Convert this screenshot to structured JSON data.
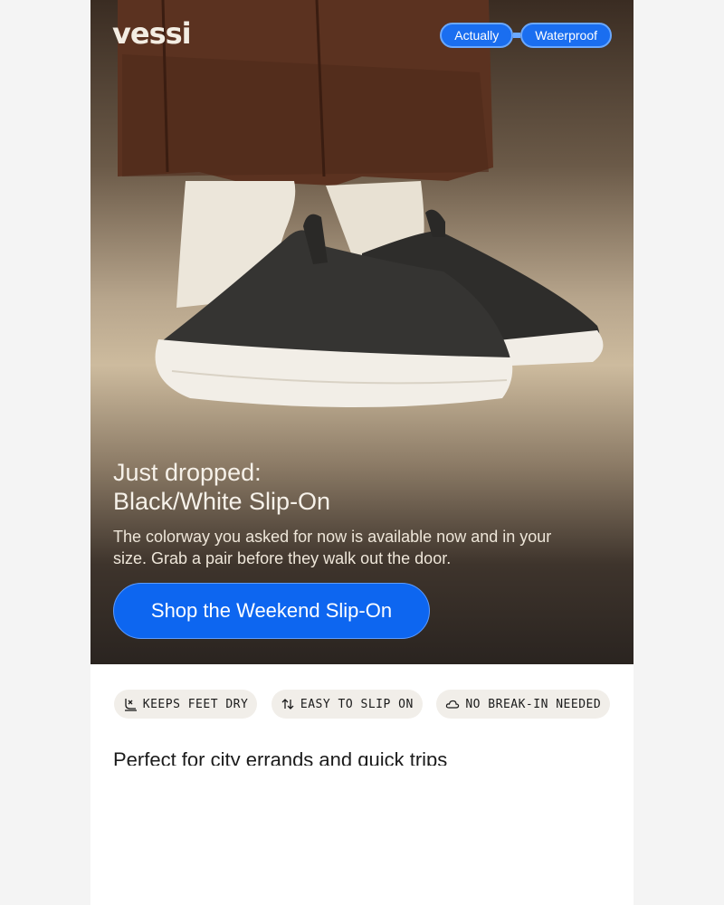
{
  "brand": {
    "logo_text": "vessi"
  },
  "hero": {
    "badges": [
      "Actually",
      "Waterproof"
    ],
    "title_line1": "Just dropped:",
    "title_line2": "Black/White Slip-On",
    "body": "The colorway you asked for now is available now and in your size. Grab a pair before they walk out the door.",
    "cta_label": "Shop the Weekend Slip-On"
  },
  "features": [
    {
      "icon": "dry-feet-icon",
      "label": "KEEPS FEET DRY"
    },
    {
      "icon": "slip-arrows-icon",
      "label": "EASY TO SLIP ON"
    },
    {
      "icon": "cloud-icon",
      "label": "NO BREAK-IN NEEDED"
    }
  ],
  "section": {
    "title": "Perfect for city errands and quick trips"
  },
  "colors": {
    "accent": "#0d66f0",
    "chip_bg": "#f1eee9"
  }
}
